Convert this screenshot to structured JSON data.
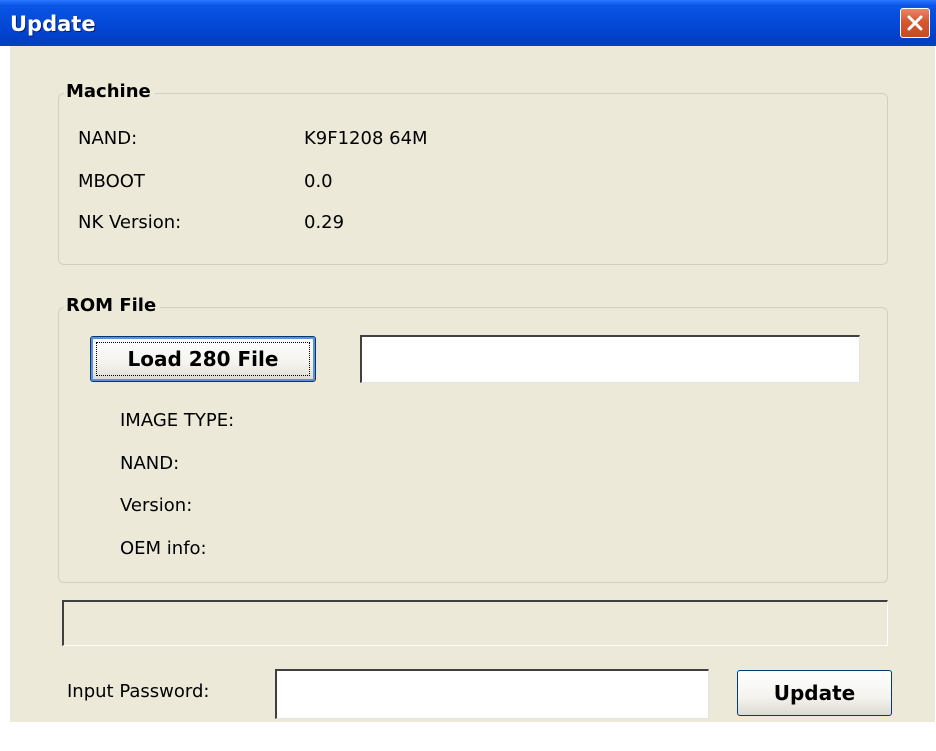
{
  "window": {
    "title": "Update",
    "close_icon": "close-x-icon"
  },
  "machine": {
    "group_title": "Machine",
    "rows": [
      {
        "label": "NAND:",
        "value": "K9F1208 64M"
      },
      {
        "label": "MBOOT",
        "value": "0.0"
      },
      {
        "label": "NK Version:",
        "value": "0.29"
      }
    ]
  },
  "rom_file": {
    "group_title": "ROM File",
    "load_button_label": "Load 280 File",
    "file_path_value": "",
    "info_labels": [
      "IMAGE TYPE:",
      "NAND:",
      "Version:",
      "OEM info:"
    ]
  },
  "progress": {
    "value_percent": 0
  },
  "password": {
    "label": "Input Password:",
    "value": ""
  },
  "update_button_label": "Update",
  "colors": {
    "titlebar": "#0348d6",
    "client_background": "#ece9d8",
    "close_button": "#d5582f"
  }
}
